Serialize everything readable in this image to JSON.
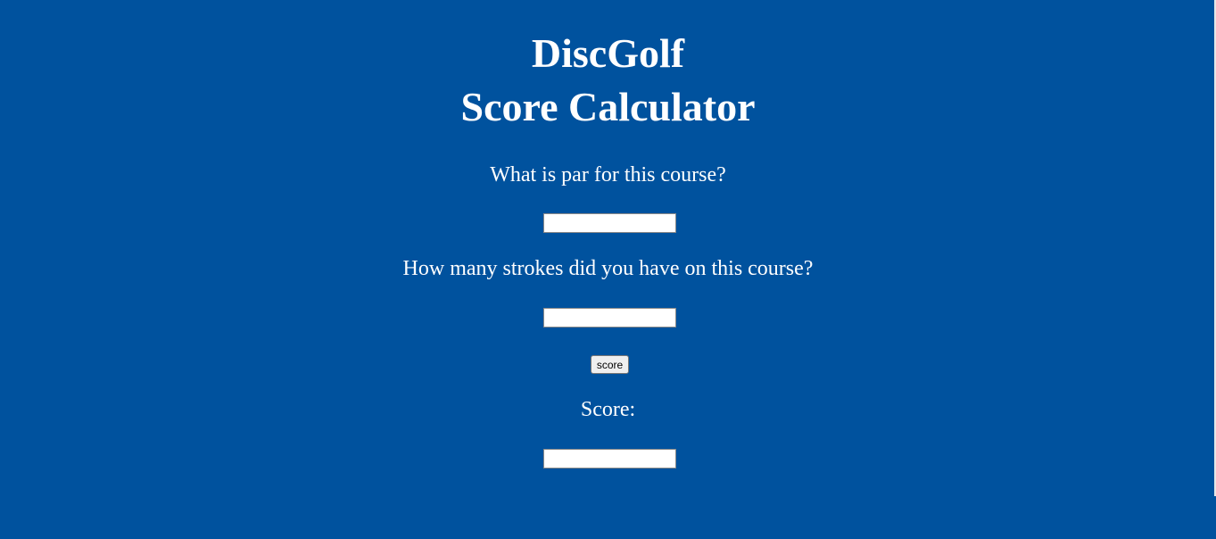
{
  "header": {
    "title_line1": "DiscGolf",
    "title_line2": "Score Calculator"
  },
  "form": {
    "par_label": "What is par for this course?",
    "par_value": "",
    "strokes_label": "How many strokes did you have on this course?",
    "strokes_value": "",
    "score_button_label": "score",
    "score_label": "Score:",
    "score_value": ""
  },
  "colors": {
    "background": "#00529e",
    "text": "#ffffff"
  }
}
